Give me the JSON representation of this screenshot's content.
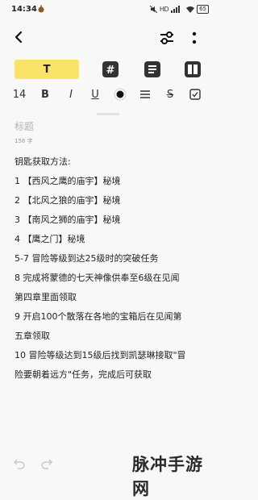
{
  "status_bar": {
    "time": "14:34",
    "network": "HD",
    "battery": "65"
  },
  "editor": {
    "text_tool_label": "T",
    "font_size": "14",
    "bold_label": "B",
    "italic_label": "I",
    "underline_label": "U",
    "strike_label": "S",
    "title_placeholder": "标题",
    "char_count": "156 字",
    "body_lines": [
      "钥匙获取方法:",
      "1 【西风之鹰的庙宇】秘境",
      "2 【北风之狼的庙宇】秘境",
      "3 【南风之狮的庙宇】秘境",
      "4 【鹰之门】秘境",
      "5-7 冒险等级到达25级时的突破任务",
      "8 完成将蒙德的七天神像供奉至6级在见闻",
      "第四章里面领取",
      "9 开启100个散落在各地的宝箱后在见闻第",
      "五章领取",
      "10 冒险等级达到15级后找到凯瑟琳接取\"冒",
      "险要朝着远方\"任务，完成后可获取"
    ]
  },
  "watermark": "脉冲手游网",
  "colors": {
    "highlight": "#fbe36a",
    "background": "#f8f8f6",
    "placeholder": "#b5b5b5"
  }
}
